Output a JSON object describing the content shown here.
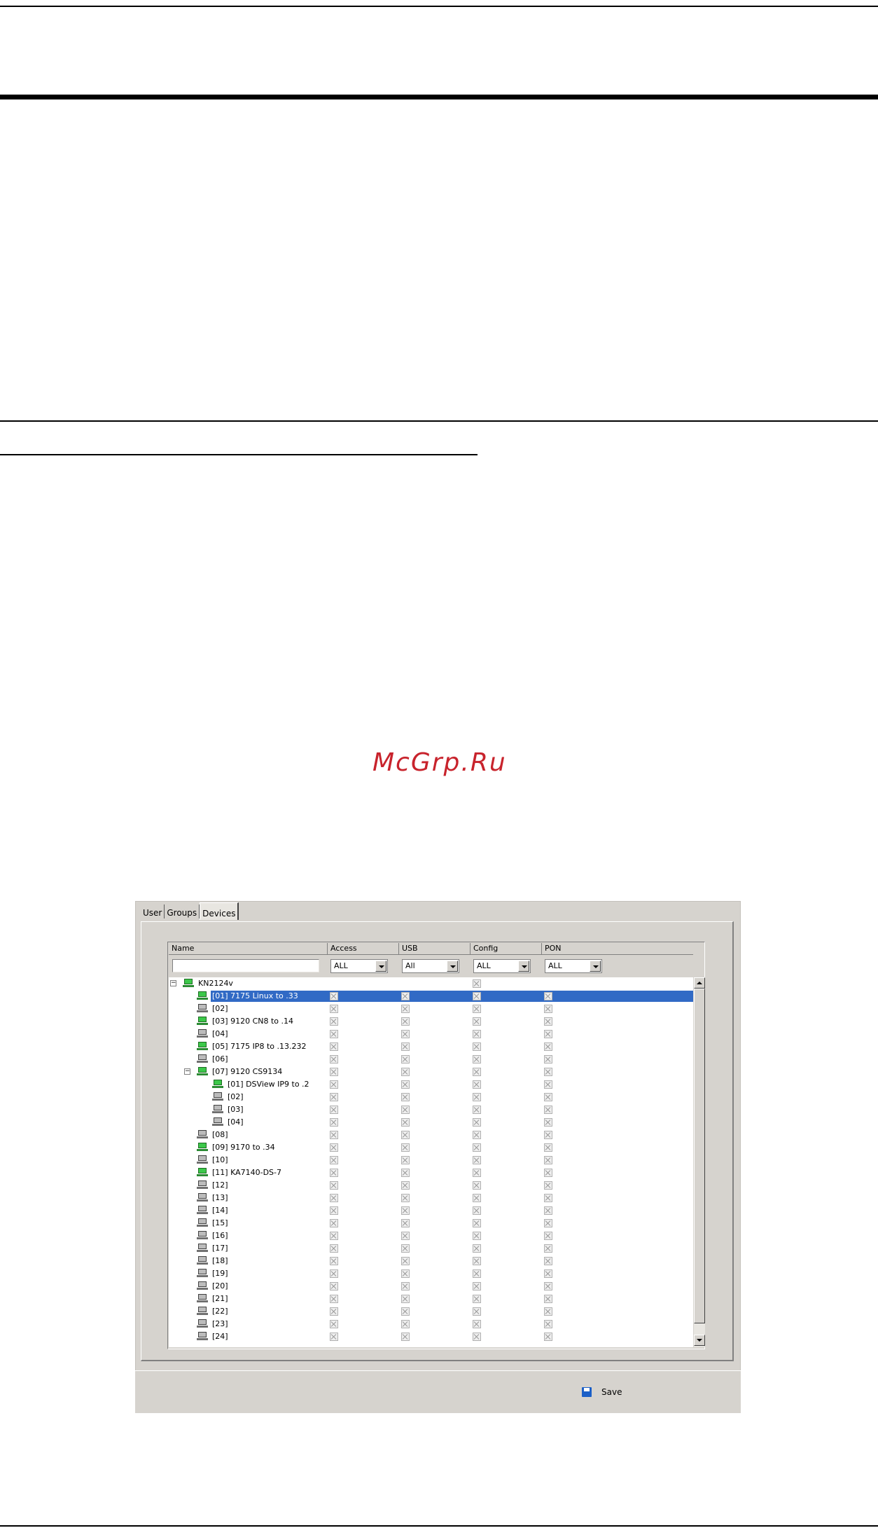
{
  "watermark": "McGrp.Ru",
  "tabs": [
    "User",
    "Groups",
    "Devices"
  ],
  "active_tab": "Devices",
  "columns": [
    "Name",
    "Access",
    "USB",
    "Config",
    "PON"
  ],
  "filters": {
    "name_value": "",
    "access": "ALL",
    "usb": "All",
    "config": "ALL",
    "pon": "ALL"
  },
  "tree": [
    {
      "label": "KN2124v",
      "level": 0,
      "icon": "network-device-icon",
      "expander": "−",
      "checks": [
        false,
        false,
        true,
        false
      ]
    },
    {
      "label": "[01] 7175 Linux to .33",
      "level": 1,
      "icon": "green-port-icon",
      "selected": true,
      "checks": [
        true,
        true,
        true,
        true
      ]
    },
    {
      "label": "[02]",
      "level": 1,
      "icon": "gray-port-icon",
      "checks": [
        true,
        true,
        true,
        true
      ]
    },
    {
      "label": "[03] 9120 CN8 to .14",
      "level": 1,
      "icon": "green-port-icon",
      "checks": [
        true,
        true,
        true,
        true
      ]
    },
    {
      "label": "[04]",
      "level": 1,
      "icon": "gray-port-icon",
      "checks": [
        true,
        true,
        true,
        true
      ]
    },
    {
      "label": "[05] 7175 IP8 to .13.232",
      "level": 1,
      "icon": "green-port-icon",
      "checks": [
        true,
        true,
        true,
        true
      ]
    },
    {
      "label": "[06]",
      "level": 1,
      "icon": "gray-port-icon",
      "checks": [
        true,
        true,
        true,
        true
      ]
    },
    {
      "label": "[07] 9120 CS9134",
      "level": 1,
      "icon": "network-device-icon",
      "expander": "−",
      "checks": [
        true,
        true,
        true,
        true
      ]
    },
    {
      "label": "[01] DSView IP9 to .2",
      "level": 2,
      "icon": "green-port-icon",
      "checks": [
        true,
        true,
        true,
        true
      ]
    },
    {
      "label": "[02]",
      "level": 2,
      "icon": "gray-port-icon",
      "checks": [
        true,
        true,
        true,
        true
      ]
    },
    {
      "label": "[03]",
      "level": 2,
      "icon": "gray-port-icon",
      "checks": [
        true,
        true,
        true,
        true
      ]
    },
    {
      "label": "[04]",
      "level": 2,
      "icon": "gray-port-icon",
      "checks": [
        true,
        true,
        true,
        true
      ]
    },
    {
      "label": "[08]",
      "level": 1,
      "icon": "gray-port-icon",
      "checks": [
        true,
        true,
        true,
        true
      ]
    },
    {
      "label": "[09] 9170 to .34",
      "level": 1,
      "icon": "green-port-icon",
      "checks": [
        true,
        true,
        true,
        true
      ]
    },
    {
      "label": "[10]",
      "level": 1,
      "icon": "gray-port-icon",
      "checks": [
        true,
        true,
        true,
        true
      ]
    },
    {
      "label": "[11] KA7140-DS-7",
      "level": 1,
      "icon": "green-port-icon",
      "checks": [
        true,
        true,
        true,
        true
      ]
    },
    {
      "label": "[12]",
      "level": 1,
      "icon": "gray-port-icon",
      "checks": [
        true,
        true,
        true,
        true
      ]
    },
    {
      "label": "[13]",
      "level": 1,
      "icon": "gray-port-icon",
      "checks": [
        true,
        true,
        true,
        true
      ]
    },
    {
      "label": "[14]",
      "level": 1,
      "icon": "gray-port-icon",
      "checks": [
        true,
        true,
        true,
        true
      ]
    },
    {
      "label": "[15]",
      "level": 1,
      "icon": "gray-port-icon",
      "checks": [
        true,
        true,
        true,
        true
      ]
    },
    {
      "label": "[16]",
      "level": 1,
      "icon": "gray-port-icon",
      "checks": [
        true,
        true,
        true,
        true
      ]
    },
    {
      "label": "[17]",
      "level": 1,
      "icon": "gray-port-icon",
      "checks": [
        true,
        true,
        true,
        true
      ]
    },
    {
      "label": "[18]",
      "level": 1,
      "icon": "gray-port-icon",
      "checks": [
        true,
        true,
        true,
        true
      ]
    },
    {
      "label": "[19]",
      "level": 1,
      "icon": "gray-port-icon",
      "checks": [
        true,
        true,
        true,
        true
      ]
    },
    {
      "label": "[20]",
      "level": 1,
      "icon": "gray-port-icon",
      "checks": [
        true,
        true,
        true,
        true
      ]
    },
    {
      "label": "[21]",
      "level": 1,
      "icon": "gray-port-icon",
      "checks": [
        true,
        true,
        true,
        true
      ]
    },
    {
      "label": "[22]",
      "level": 1,
      "icon": "gray-port-icon",
      "checks": [
        true,
        true,
        true,
        true
      ]
    },
    {
      "label": "[23]",
      "level": 1,
      "icon": "gray-port-icon",
      "checks": [
        true,
        true,
        true,
        true
      ]
    },
    {
      "label": "[24]",
      "level": 1,
      "icon": "gray-port-icon",
      "checks": [
        true,
        true,
        true,
        true
      ]
    }
  ],
  "footer": {
    "save_label": "Save"
  },
  "colors": {
    "selection": "#316ac5",
    "watermark": "#c8232c",
    "window_bg": "#d6d3ce"
  }
}
